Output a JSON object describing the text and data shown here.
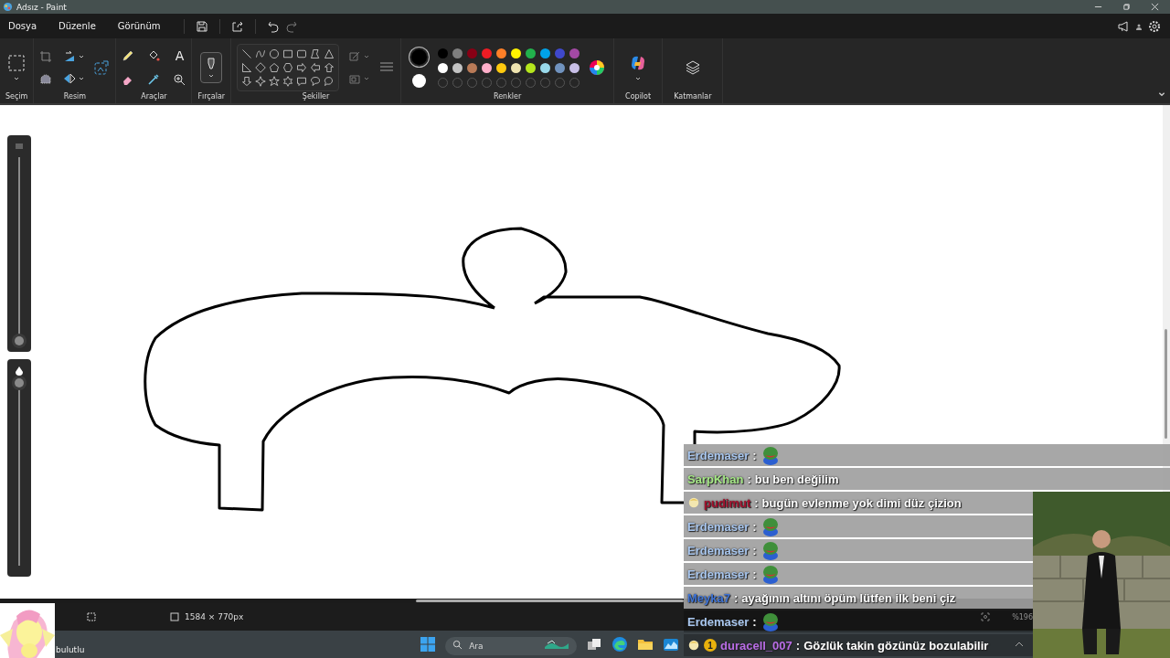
{
  "window": {
    "title": "Adsız - Paint"
  },
  "menu": [
    {
      "label": "Dosya"
    },
    {
      "label": "Düzenle"
    },
    {
      "label": "Görünüm"
    }
  ],
  "ribbon_groups": [
    {
      "kind": "selection",
      "label": "Seçim"
    },
    {
      "label": "Resim"
    },
    {
      "kind": "tools",
      "label": "Araçlar",
      "text_tool": "A"
    },
    {
      "kind": "brushes",
      "label": "Fırçalar"
    },
    {
      "kind": "shapes",
      "label": "Şekiller"
    },
    {
      "kind": "colors",
      "label": "Renkler"
    },
    {
      "kind": "copilot",
      "label": "Copilot"
    },
    {
      "kind": "layers",
      "label": "Katmanlar"
    }
  ],
  "colors": {
    "current": [
      {
        "color": "#000000"
      },
      {
        "color": "#ffffff"
      }
    ],
    "swatches": [
      {
        "color": "#000000"
      },
      {
        "color": "#7f7f7f"
      },
      {
        "color": "#880015"
      },
      {
        "color": "#ed1c24"
      },
      {
        "color": "#ff7f27"
      },
      {
        "color": "#fff200"
      },
      {
        "color": "#22b14c"
      },
      {
        "color": "#00a2e8"
      },
      {
        "color": "#3f48cc"
      },
      {
        "color": "#a349a4"
      },
      {
        "color": "#ffffff"
      },
      {
        "color": "#c3c3c3"
      },
      {
        "color": "#b97a57"
      },
      {
        "color": "#ffaec9"
      },
      {
        "color": "#ffc90e"
      },
      {
        "color": "#efe4b0"
      },
      {
        "color": "#b5e61d"
      },
      {
        "color": "#99d9ea"
      },
      {
        "color": "#7092be"
      },
      {
        "color": "#c8bfe7"
      }
    ]
  },
  "side_sliders": [
    {
      "kind": "size",
      "level": 0
    },
    {
      "kind": "opacity",
      "level": 1
    }
  ],
  "status_bar": {
    "canvas_size": "1584 × 770px",
    "zoom": "%196"
  },
  "taskbar": {
    "weather": "bulutlu",
    "search": {
      "placeholder": "Ara"
    }
  },
  "chat": [
    {
      "user": "Erdemaser",
      "separator": ":",
      "color": "#a8c6ee",
      "kind": "emote",
      "badge": false,
      "shaded": true
    },
    {
      "user": "SarpKhan",
      "separator": ":",
      "color": "#a6e887",
      "kind": "text",
      "message": "bu ben değilim",
      "badge": false,
      "shaded": true
    },
    {
      "user": "pudimut",
      "separator": ":",
      "color": "#a4122e",
      "kind": "text",
      "message": "bugün evlenme yok dimi düz çizion",
      "badge": true,
      "shaded": true
    },
    {
      "user": "Erdemaser",
      "separator": ":",
      "color": "#a8c6ee",
      "kind": "emote",
      "badge": false,
      "shaded": true
    },
    {
      "user": "Erdemaser",
      "separator": ":",
      "color": "#a8c6ee",
      "kind": "emote",
      "badge": false,
      "shaded": true
    },
    {
      "user": "Erdemaser",
      "separator": ":",
      "color": "#a8c6ee",
      "kind": "emote",
      "badge": false,
      "shaded": true
    },
    {
      "user": "Meyka7",
      "separator": ":",
      "color": "#3f74d6",
      "kind": "text",
      "message": "ayağının altını öpüm lütfen ilk beni çiz",
      "badge": false,
      "shaded": true
    },
    {
      "user": "Erdemaser",
      "separator": ":",
      "color": "#a8c6ee",
      "kind": "emote",
      "badge": false,
      "shaded": false
    },
    {
      "user": "duracell_007",
      "separator": ":",
      "color": "#b86de6",
      "kind": "text",
      "message": "Gözlük takin gözünüz bozulabilir",
      "badge": true,
      "badge_count": "1",
      "shaded": false
    }
  ]
}
